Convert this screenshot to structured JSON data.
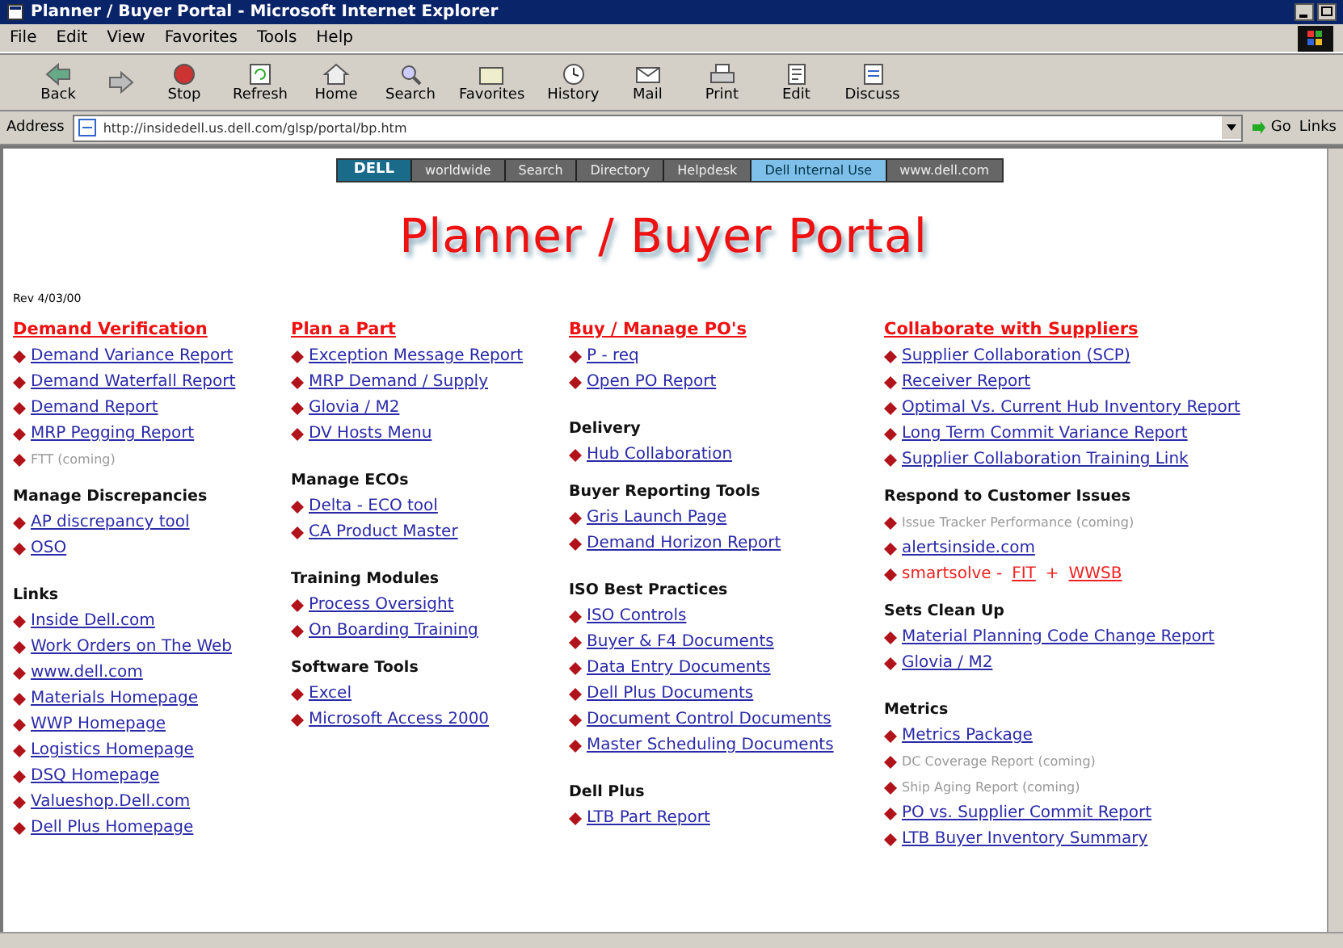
{
  "window": {
    "title": "Planner / Buyer Portal - Microsoft Internet Explorer"
  },
  "menu": [
    "File",
    "Edit",
    "View",
    "Favorites",
    "Tools",
    "Help"
  ],
  "toolbar": [
    {
      "kind": "back",
      "label": "Back"
    },
    {
      "kind": "forward"
    },
    {
      "kind": "stop",
      "label": "Stop"
    },
    {
      "kind": "refresh",
      "label": "Refresh"
    },
    {
      "kind": "home",
      "label": "Home"
    },
    {
      "kind": "search",
      "label": "Search"
    },
    {
      "kind": "favorites",
      "label": "Favorites"
    },
    {
      "kind": "history",
      "label": "History"
    },
    {
      "kind": "mail",
      "label": "Mail"
    },
    {
      "kind": "print",
      "label": "Print"
    },
    {
      "kind": "edit",
      "label": "Edit"
    },
    {
      "kind": "discuss",
      "label": "Discuss"
    }
  ],
  "address": {
    "label": "Address",
    "value": "http://insidedell.us.dell.com/glsp/portal/bp.htm",
    "go": "Go",
    "links": "Links"
  },
  "nav": [
    {
      "kind": "logo",
      "label": "DELL",
      "selected": false
    },
    {
      "kind": "tab",
      "label": "worldwide",
      "selected": false
    },
    {
      "kind": "tab",
      "label": "Search",
      "selected": false
    },
    {
      "kind": "tab",
      "label": "Directory",
      "selected": false
    },
    {
      "kind": "tab",
      "label": "Helpdesk",
      "selected": false
    },
    {
      "kind": "tab",
      "label": "Dell Internal Use",
      "selected": true
    },
    {
      "kind": "tab",
      "label": "www.dell.com",
      "selected": false
    }
  ],
  "page_title": "Planner / Buyer Portal",
  "revision": "Rev 4/03/00",
  "columns": [
    [
      {
        "heading": "Demand Verification",
        "kind": "category",
        "items": [
          {
            "kind": "link",
            "text": "Demand Variance Report"
          },
          {
            "kind": "link",
            "text": "Demand Waterfall Report"
          },
          {
            "kind": "link",
            "text": "Demand Report"
          },
          {
            "kind": "link",
            "text": "MRP Pegging Report"
          },
          {
            "kind": "pending",
            "text": "FTT (coming)"
          }
        ]
      },
      {
        "heading": "Manage Discrepancies",
        "kind": "group",
        "items": [
          {
            "kind": "link",
            "text": "AP discrepancy tool"
          },
          {
            "kind": "link",
            "text": "OSO"
          }
        ]
      },
      {
        "heading": "Links",
        "kind": "group",
        "gap": true,
        "items": [
          {
            "kind": "link",
            "text": "Inside Dell.com"
          },
          {
            "kind": "link",
            "text": "Work Orders on The Web"
          },
          {
            "kind": "link",
            "text": "www.dell.com"
          },
          {
            "kind": "link",
            "text": "Materials Homepage"
          },
          {
            "kind": "link",
            "text": "WWP Homepage"
          },
          {
            "kind": "link",
            "text": "Logistics Homepage"
          },
          {
            "kind": "link",
            "text": "DSQ Homepage"
          },
          {
            "kind": "link",
            "text": "Valueshop.Dell.com"
          },
          {
            "kind": "link",
            "text": "Dell Plus Homepage"
          }
        ]
      }
    ],
    [
      {
        "heading": "Plan a Part",
        "kind": "category",
        "items": [
          {
            "kind": "link",
            "text": "Exception Message Report"
          },
          {
            "kind": "link",
            "text": "MRP Demand / Supply"
          },
          {
            "kind": "link",
            "text": "Glovia / M2"
          },
          {
            "kind": "link",
            "text": "DV Hosts Menu"
          }
        ]
      },
      {
        "heading": "Manage ECOs",
        "kind": "group",
        "gap": true,
        "items": [
          {
            "kind": "link",
            "text": "Delta - ECO tool"
          },
          {
            "kind": "link",
            "text": "CA Product Master"
          }
        ]
      },
      {
        "heading": "Training Modules",
        "kind": "group",
        "gap": true,
        "items": [
          {
            "kind": "link",
            "text": "Process Oversight"
          },
          {
            "kind": "link",
            "text": "On Boarding Training"
          }
        ]
      },
      {
        "heading": "Software Tools",
        "kind": "group",
        "items": [
          {
            "kind": "link",
            "text": "Excel"
          },
          {
            "kind": "link",
            "text": "Microsoft Access 2000"
          }
        ]
      }
    ],
    [
      {
        "heading": "Buy / Manage PO's",
        "kind": "category",
        "items": [
          {
            "kind": "link",
            "text": "P - req"
          },
          {
            "kind": "link",
            "text": "Open PO Report"
          }
        ]
      },
      {
        "heading": "Delivery",
        "kind": "group",
        "gap": true,
        "items": [
          {
            "kind": "link",
            "text": "Hub Collaboration"
          }
        ]
      },
      {
        "heading": "Buyer Reporting Tools",
        "kind": "group",
        "items": [
          {
            "kind": "link",
            "text": "Gris Launch Page"
          },
          {
            "kind": "link",
            "text": "Demand Horizon Report"
          }
        ]
      },
      {
        "heading": "ISO Best Practices",
        "kind": "group",
        "gap": true,
        "items": [
          {
            "kind": "link",
            "text": "ISO Controls"
          },
          {
            "kind": "link",
            "text": "Buyer & F4 Documents"
          },
          {
            "kind": "link",
            "text": "Data Entry Documents"
          },
          {
            "kind": "link",
            "text": "Dell Plus Documents"
          },
          {
            "kind": "link",
            "text": "Document Control Documents"
          },
          {
            "kind": "link",
            "text": "Master Scheduling Documents"
          }
        ]
      },
      {
        "heading": "Dell Plus",
        "kind": "group",
        "gap": true,
        "items": [
          {
            "kind": "link",
            "text": "LTB Part Report"
          }
        ]
      }
    ],
    [
      {
        "heading": "Collaborate with Suppliers",
        "kind": "category",
        "items": [
          {
            "kind": "link",
            "text": "Supplier Collaboration (SCP)"
          },
          {
            "kind": "link",
            "text": "Receiver Report"
          },
          {
            "kind": "link",
            "text": "Optimal Vs. Current Hub Inventory Report"
          },
          {
            "kind": "link",
            "text": "Long Term Commit Variance Report"
          },
          {
            "kind": "link",
            "text": "Supplier Collaboration Training Link"
          }
        ]
      },
      {
        "heading": "Respond to Customer Issues",
        "kind": "group",
        "items": [
          {
            "kind": "pending",
            "text": "Issue Tracker Performance (coming)"
          },
          {
            "kind": "link",
            "text": "alertsinside.com"
          },
          {
            "kind": "mixed",
            "parts": [
              {
                "text": "smartsolve -",
                "link": false
              },
              {
                "text": "FIT",
                "link": true
              },
              {
                "text": "+",
                "link": false
              },
              {
                "text": "WWSB",
                "link": true
              }
            ]
          }
        ]
      },
      {
        "heading": "Sets Clean Up",
        "kind": "group",
        "items": [
          {
            "kind": "link",
            "text": "Material Planning Code Change Report"
          },
          {
            "kind": "link",
            "text": "Glovia / M2"
          }
        ]
      },
      {
        "heading": "Metrics",
        "kind": "group",
        "gap": true,
        "items": [
          {
            "kind": "link",
            "text": "Metrics Package"
          },
          {
            "kind": "pending",
            "text": "DC Coverage Report (coming)"
          },
          {
            "kind": "pending",
            "text": "Ship Aging Report (coming)"
          },
          {
            "kind": "link",
            "text": "PO vs. Supplier Commit Report"
          },
          {
            "kind": "link",
            "text": "LTB Buyer Inventory Summary"
          }
        ]
      }
    ]
  ]
}
